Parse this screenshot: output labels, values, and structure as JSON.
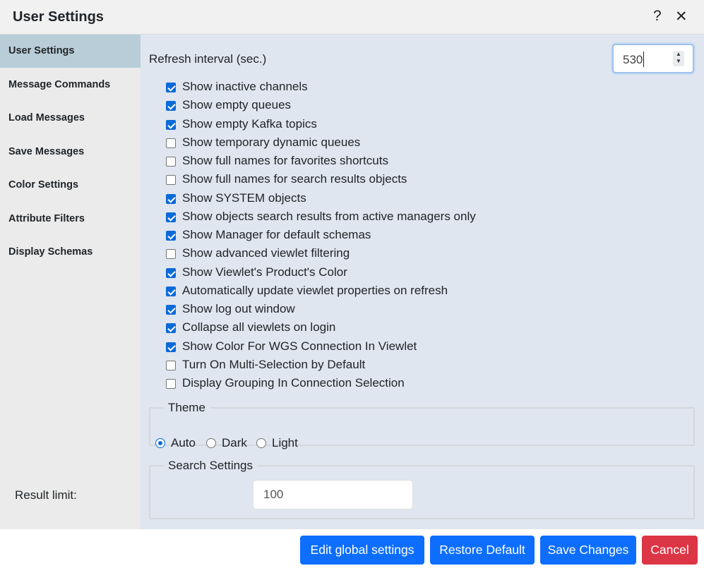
{
  "dialog": {
    "title": "User Settings",
    "help_label": "?",
    "close_label": "✕"
  },
  "sidebar": {
    "items": [
      {
        "label": "User Settings",
        "active": true
      },
      {
        "label": "Message Commands"
      },
      {
        "label": "Load Messages"
      },
      {
        "label": "Save Messages"
      },
      {
        "label": "Color Settings"
      },
      {
        "label": "Attribute Filters"
      },
      {
        "label": "Display Schemas"
      }
    ]
  },
  "refresh": {
    "label": "Refresh interval (sec.)",
    "value": "530"
  },
  "options": [
    {
      "label": "Show inactive channels",
      "checked": true
    },
    {
      "label": "Show empty queues",
      "checked": true
    },
    {
      "label": "Show empty Kafka topics",
      "checked": true
    },
    {
      "label": "Show temporary dynamic queues",
      "checked": false
    },
    {
      "label": "Show full names for favorites shortcuts",
      "checked": false
    },
    {
      "label": "Show full names for search results objects",
      "checked": false
    },
    {
      "label": "Show SYSTEM objects",
      "checked": true
    },
    {
      "label": "Show objects search results from active managers only",
      "checked": true
    },
    {
      "label": "Show Manager for default schemas",
      "checked": true
    },
    {
      "label": "Show advanced viewlet filtering",
      "checked": false
    },
    {
      "label": "Show Viewlet's Product's Color",
      "checked": true
    },
    {
      "label": "Automatically update viewlet properties on refresh",
      "checked": true
    },
    {
      "label": "Show log out window",
      "checked": true
    },
    {
      "label": "Collapse all viewlets on login",
      "checked": true
    },
    {
      "label": "Show Color For WGS Connection In Viewlet",
      "checked": true
    },
    {
      "label": "Turn On Multi-Selection by Default",
      "checked": false
    },
    {
      "label": "Display Grouping In Connection Selection",
      "checked": false
    }
  ],
  "theme": {
    "legend": "Theme",
    "options": [
      {
        "label": "Auto",
        "selected": true
      },
      {
        "label": "Dark",
        "selected": false
      },
      {
        "label": "Light",
        "selected": false
      }
    ]
  },
  "search": {
    "legend": "Search Settings",
    "result_label": "Result limit:",
    "result_value": "100"
  },
  "buttons": {
    "edit_global": "Edit global settings",
    "restore_default": "Restore Default",
    "save_changes": "Save Changes",
    "cancel": "Cancel"
  },
  "colors": {
    "primary": "#0d6efd",
    "danger": "#dc3545",
    "sidebar_active": "#b9cdd8",
    "main_bg": "#dfe6ef"
  }
}
